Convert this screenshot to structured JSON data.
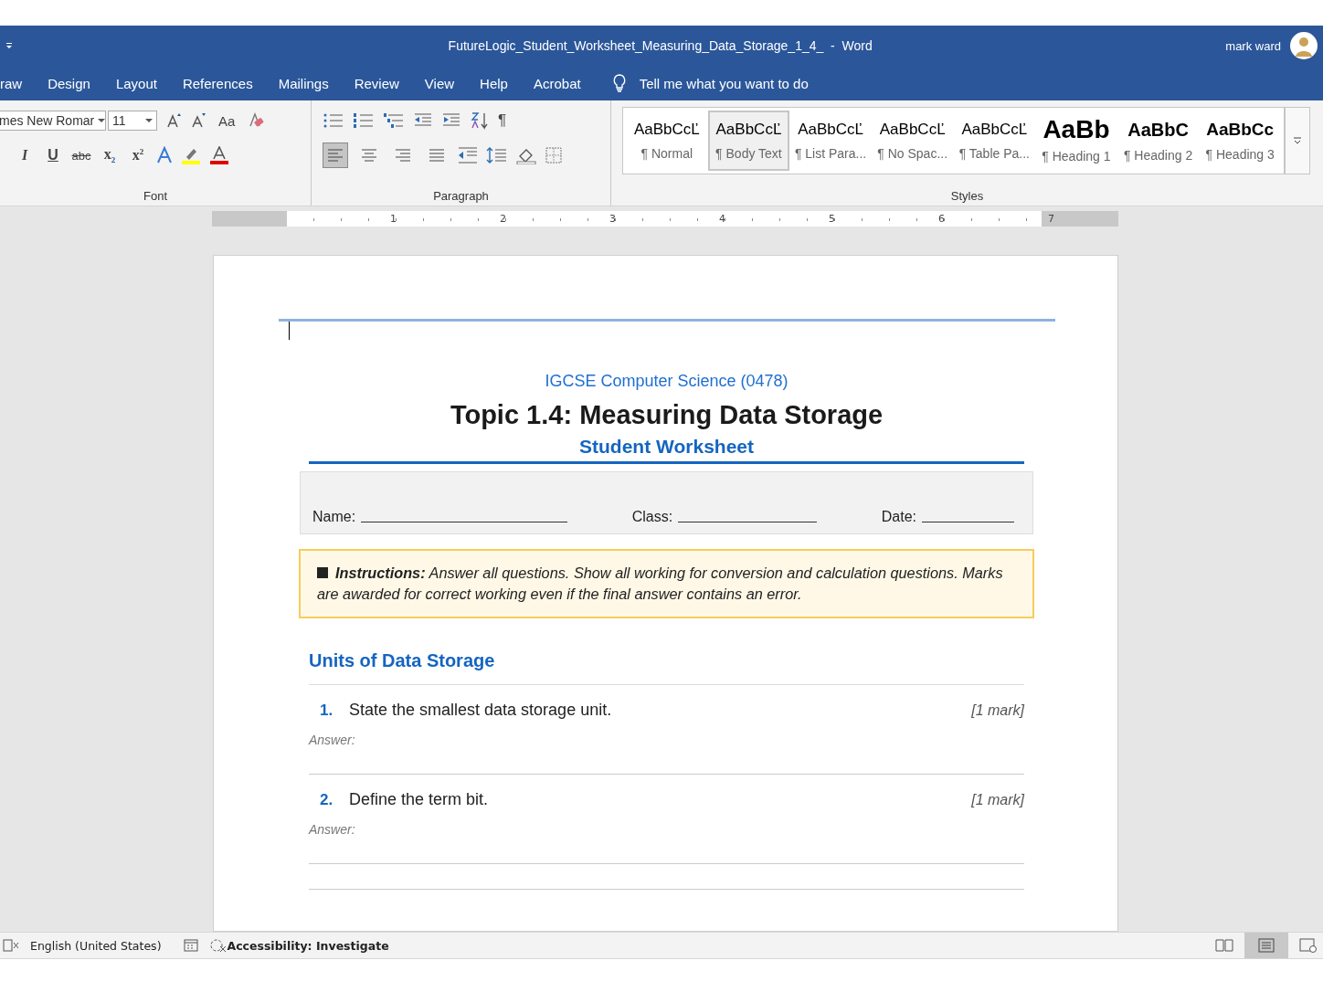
{
  "title_bar": {
    "title": "FutureLogic_Student_Worksheet_Measuring_Data_Storage_1_4_  -  Word",
    "user_name": "mark ward"
  },
  "menu_tabs": [
    {
      "label": "raw",
      "selected": false
    },
    {
      "label": "Design",
      "selected": false
    },
    {
      "label": "Layout",
      "selected": false
    },
    {
      "label": "References",
      "selected": false
    },
    {
      "label": "Mailings",
      "selected": false
    },
    {
      "label": "Review",
      "selected": false
    },
    {
      "label": "View",
      "selected": false
    },
    {
      "label": "Help",
      "selected": false
    },
    {
      "label": "Acrobat",
      "selected": false
    }
  ],
  "tell_me": {
    "placeholder": "Tell me what you want to do"
  },
  "font_group": {
    "label": "Font",
    "font_name": "mes New Romar",
    "font_size": "11",
    "case_button": "Aa",
    "format_buttons": [
      {
        "kind": "italic",
        "label": "I"
      },
      {
        "kind": "underline",
        "label": "U"
      },
      {
        "kind": "strike",
        "label": "abc"
      },
      {
        "kind": "sub",
        "label": "x",
        "mark": "2"
      },
      {
        "kind": "sup",
        "label": "x",
        "mark": "2"
      }
    ]
  },
  "paragraph_group": {
    "label": "Paragraph",
    "pilcrow": "¶",
    "align_buttons": [
      {
        "kind": "left",
        "selected": true
      },
      {
        "kind": "center",
        "selected": false
      },
      {
        "kind": "right",
        "selected": false
      },
      {
        "kind": "justify",
        "selected": false
      }
    ]
  },
  "styles_group": {
    "label": "Styles",
    "styles": [
      {
        "preview": "AaBbCcĽ",
        "name": "¶ Normal",
        "kind": "normal",
        "selected": false
      },
      {
        "preview": "AaBbCcĽ",
        "name": "¶ Body Text",
        "kind": "normal",
        "selected": true
      },
      {
        "preview": "AaBbCcĽ",
        "name": "¶ List Para...",
        "kind": "normal",
        "selected": false
      },
      {
        "preview": "AaBbCcĽ",
        "name": "¶ No Spac...",
        "kind": "normal",
        "selected": false
      },
      {
        "preview": "AaBbCcĽ",
        "name": "¶ Table Pa...",
        "kind": "normal",
        "selected": false
      },
      {
        "preview": "AaBb",
        "name": "¶ Heading 1",
        "kind": "heading1",
        "selected": false
      },
      {
        "preview": "AaBbC",
        "name": "¶ Heading 2",
        "kind": "heading2",
        "selected": false
      },
      {
        "preview": "AaBbCc",
        "name": "¶ Heading 3",
        "kind": "heading3",
        "selected": false
      }
    ]
  },
  "ruler": {
    "numbers": [
      "1",
      "2",
      "3",
      "4",
      "5",
      "6",
      "7"
    ]
  },
  "document": {
    "subject": "IGCSE Computer Science (0478)",
    "title": "Topic 1.4: Measuring Data Storage",
    "subtitle": "Student Worksheet",
    "fields": [
      {
        "label": "Name:"
      },
      {
        "label": "Class:"
      },
      {
        "label": "Date:"
      }
    ],
    "instructions": "**Instructions:** Answer all questions. Show all working for conversion and calculation questions. Marks are awarded for correct working even if the final answer contains an error.",
    "section_heading": "Units of Data Storage",
    "questions": [
      {
        "number": "1.",
        "text": "State the smallest data storage unit.",
        "marks": "[1 mark]",
        "answer_label": "Answer:"
      },
      {
        "number": "2.",
        "text": "Define the term bit.",
        "marks": "[1 mark]",
        "answer_label": "Answer:"
      }
    ]
  },
  "status_bar": {
    "language": "English (United States)",
    "accessibility": "Accessibility: Investigate"
  }
}
